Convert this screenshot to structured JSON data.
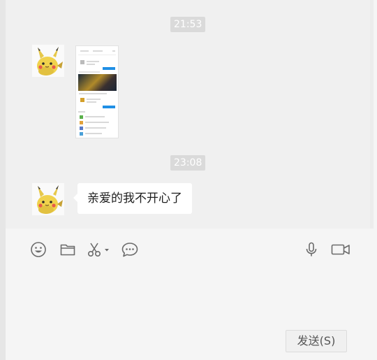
{
  "history": {
    "messages": [
      {
        "time": "21:53",
        "type": "image"
      },
      {
        "time": "23:08",
        "type": "text",
        "text": "亲爱的我不开心了"
      }
    ]
  },
  "composer": {
    "tools": [
      "emoji-icon",
      "folder-icon",
      "scissors-icon",
      "chat-bubble-icon",
      "microphone-icon",
      "video-camera-icon"
    ],
    "send_label": "发送(S)"
  },
  "colors": {
    "history_bg": "#f0f0f0",
    "composer_bg": "#f5f5f5",
    "bubble_bg": "#ffffff",
    "time_badge_bg": "#dadada",
    "icon": "#6b6b6b"
  }
}
